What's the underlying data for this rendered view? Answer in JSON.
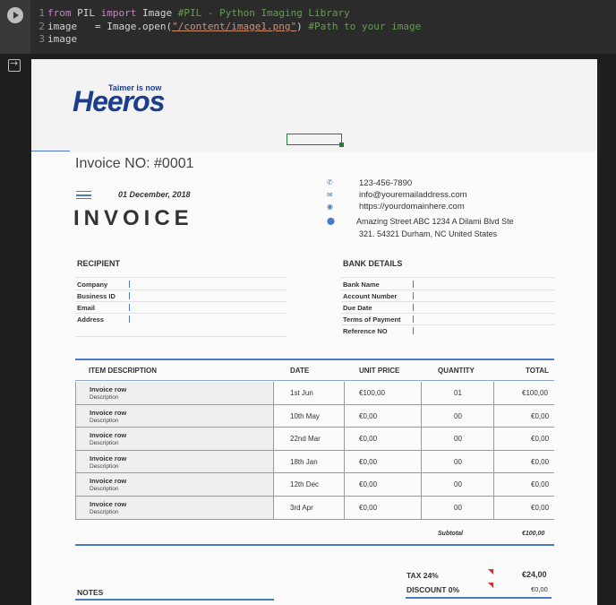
{
  "code": {
    "lines": [
      {
        "num": "1",
        "kw1": "from",
        "mid1": " PIL ",
        "kw2": "import",
        "mid2": " Image ",
        "comment": "#PIL - Python Imaging Library"
      },
      {
        "num": "2",
        "pre": "image   = Image.open(",
        "str": "\"/content/image1.png\"",
        "post": ") ",
        "comment": "#Path to your image"
      },
      {
        "num": "3",
        "text": "image"
      }
    ]
  },
  "invoice": {
    "logo_tagline": "Taimer is now",
    "logo_text": "Heeros",
    "number": "Invoice  NO: #0001",
    "date": "01 December, 2018",
    "title": "INVOICE",
    "contact": {
      "phone": "123-456-7890",
      "email": "info@youremailaddress.com",
      "web": "https://yourdomainhere.com",
      "address_line1": "Amazing Street ABC 1234 A Dilami Blvd Ste",
      "address_line2": "321. 54321 Durham, NC United States"
    },
    "recipient": {
      "heading": "RECIPIENT",
      "fields": [
        "Company",
        "Business ID",
        "Email",
        "Address"
      ]
    },
    "bank": {
      "heading": "BANK DETAILS",
      "fields": [
        "Bank Name",
        "Account Number",
        "Due Date",
        "Terms of Payment",
        "Reference NO"
      ]
    },
    "table": {
      "headers": [
        "ITEM DESCRIPTION",
        "DATE",
        "UNIT PRICE",
        "QUANTITY",
        "TOTAL"
      ],
      "rows": [
        {
          "title": "Invoice row",
          "desc": "Description",
          "date": "1st Jun",
          "price": "€100,00",
          "qty": "01",
          "total": "€100,00"
        },
        {
          "title": "Invoice row",
          "desc": "Description",
          "date": "10th May",
          "price": "€0,00",
          "qty": "00",
          "total": "€0,00"
        },
        {
          "title": "Invoice row",
          "desc": "Description",
          "date": "22nd Mar",
          "price": "€0,00",
          "qty": "00",
          "total": "€0,00"
        },
        {
          "title": "Invoice row",
          "desc": "Description",
          "date": "18th Jan",
          "price": "€0,00",
          "qty": "00",
          "total": "€0,00"
        },
        {
          "title": "Invoice row",
          "desc": "Description",
          "date": "12th Dec",
          "price": "€0,00",
          "qty": "00",
          "total": "€0,00"
        },
        {
          "title": "Invoice row",
          "desc": "Description",
          "date": "3rd Apr",
          "price": "€0,00",
          "qty": "00",
          "total": "€0,00"
        }
      ],
      "subtotal_label": "Subtotal",
      "subtotal_value": "€100,00"
    },
    "tax_label": "TAX 24%",
    "tax_value": "€24,00",
    "discount_label": "DISCOUNT 0%",
    "discount_value": "€0,00",
    "notes_label": "NOTES"
  }
}
